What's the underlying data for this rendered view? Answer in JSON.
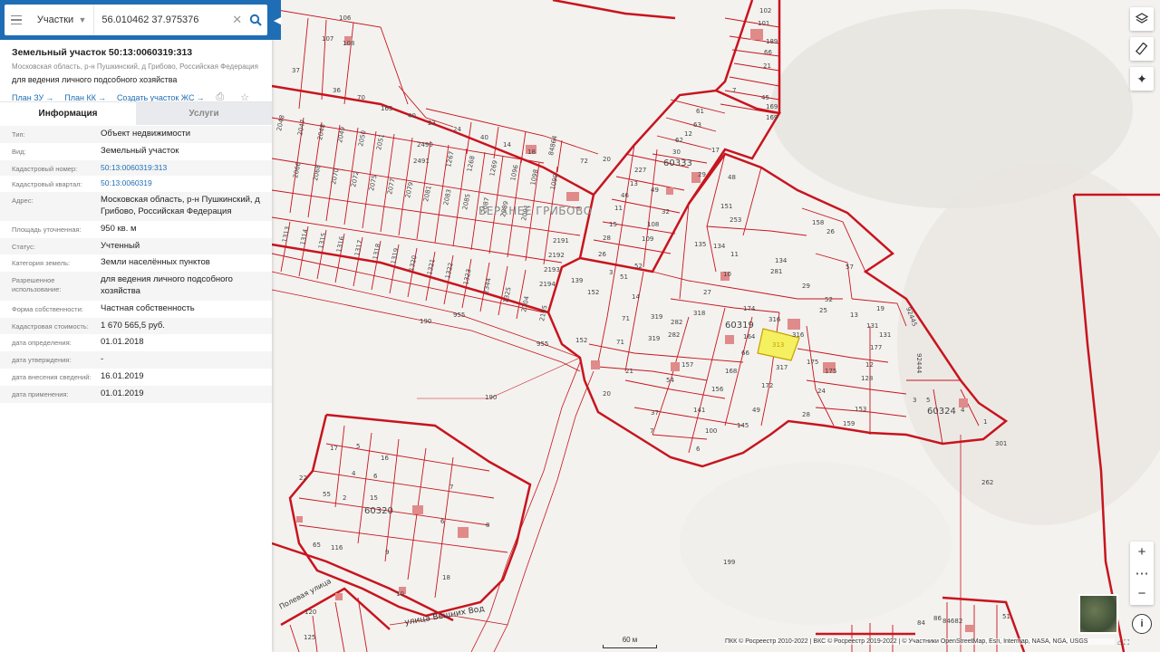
{
  "search": {
    "layer": "Участки",
    "query": "56.010462 37.975376"
  },
  "parcel": {
    "title": "Земельный участок 50:13:0060319:313",
    "address_line": "Московская область, р-н Пушкинский, д Грибово, Российская Федерация",
    "usage_line": "для ведения личного подсобного хозяйства",
    "links": [
      "План ЗУ",
      "План КК",
      "Создать участок ЖС"
    ]
  },
  "tabs": [
    "Информация",
    "Услуги"
  ],
  "info_rows": [
    {
      "label": "Тип:",
      "value": "Объект недвижимости",
      "link": false
    },
    {
      "label": "Вид:",
      "value": "Земельный участок",
      "link": false
    },
    {
      "label": "Кадастровый номер:",
      "value": "50:13:0060319:313",
      "link": true
    },
    {
      "label": "Кадастровый квартал:",
      "value": "50:13:0060319",
      "link": true
    },
    {
      "label": "Адрес:",
      "value": "Московская область, р-н Пушкинский, д Грибово, Российская Федерация",
      "link": false
    },
    {
      "label": "Площадь уточненная:",
      "value": "950 кв. м",
      "link": false
    },
    {
      "label": "Статус:",
      "value": "Учтенный",
      "link": false
    },
    {
      "label": "Категория земель:",
      "value": "Земли населённых пунктов",
      "link": false
    },
    {
      "label": "Разрешенное использование:",
      "value": "для ведения личного подсобного хозяйства",
      "link": false
    },
    {
      "label": "Форма собственности:",
      "value": "Частная собственность",
      "link": false
    },
    {
      "label": "Кадастровая стоимость:",
      "value": "1 670 565,5 руб.",
      "link": false
    },
    {
      "label": "дата определения:",
      "value": "01.01.2018",
      "link": false
    },
    {
      "label": "дата утверждения:",
      "value": "-",
      "link": false
    },
    {
      "label": "дата внесения сведений:",
      "value": "16.01.2019",
      "link": false
    },
    {
      "label": "дата применения:",
      "value": "01.01.2019",
      "link": false
    }
  ],
  "map": {
    "locality_label": "ВЕРХНЕЕ ГРИБОВО",
    "quarter_labels": [
      "60333",
      "60319",
      "60324",
      "60320"
    ],
    "street_labels": [
      "улица Вешних Вод",
      "Полевая улица"
    ],
    "selected_parcel": "313",
    "scale_label": "60 м",
    "attribution": "ПКК © Росреестр 2010-2022 | ВКС © Росреестр 2019-2022 | © Участники OpenStreetMap, Esri, Intermap, NASA, NGA, USGS",
    "colors": {
      "boundary": "#c8141e",
      "selected_fill": "#f5f060",
      "building": "#e08a8a"
    }
  }
}
